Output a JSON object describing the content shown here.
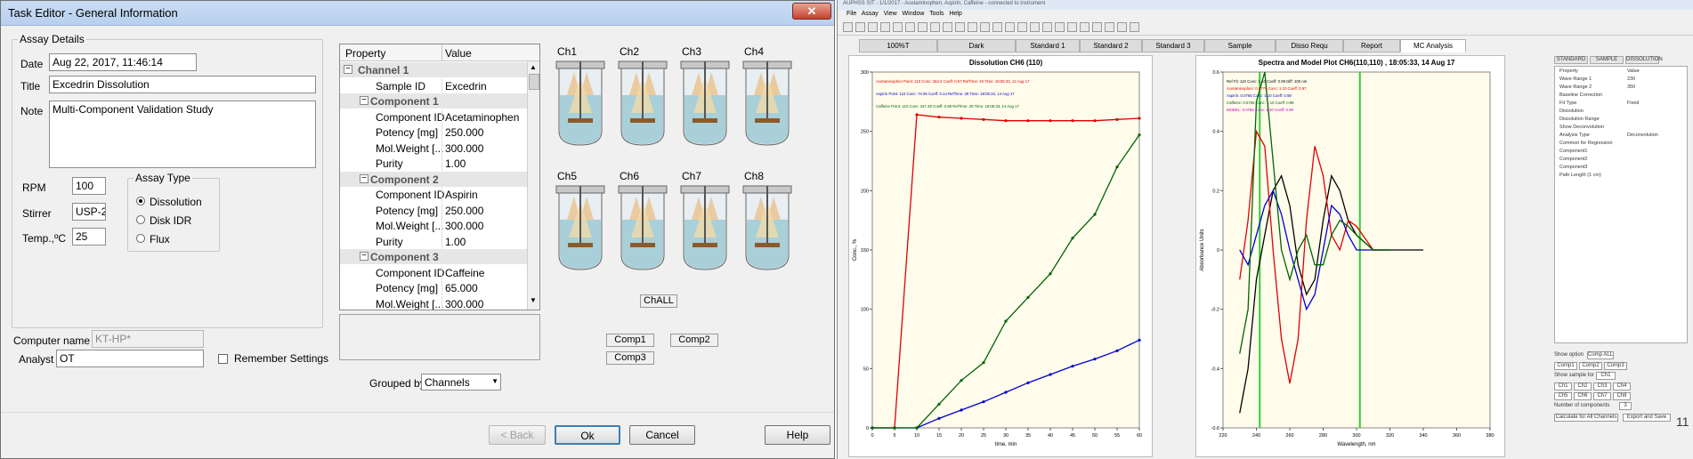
{
  "dialog": {
    "title": "Task Editor - General Information",
    "close_symbol": "✕",
    "assay_details": {
      "legend": "Assay Details",
      "date_label": "Date",
      "date_value": "Aug 22, 2017, 11:46:14",
      "title_label": "Title",
      "title_value": "Excedrin Dissolution",
      "note_label": "Note",
      "note_value": "Multi-Component Validation Study",
      "rpm_label": "RPM",
      "rpm_value": "100",
      "stirrer_label": "Stirrer",
      "stirrer_value": "USP-2",
      "temp_label": "Temp.,ºC",
      "temp_value": "25",
      "assay_type": {
        "legend": "Assay Type",
        "options": [
          "Dissolution",
          "Disk IDR",
          "Flux"
        ],
        "selected": "Dissolution"
      }
    },
    "computer_name_label": "Computer name",
    "computer_name_value": "KT-HP*",
    "analyst_label": "Analyst",
    "analyst_value": "OT",
    "remember_label": "Remember Settings",
    "grid": {
      "col_property": "Property",
      "col_value": "Value",
      "rows": [
        {
          "type": "group",
          "label": "Channel 1"
        },
        {
          "type": "item",
          "label": "Sample ID",
          "value": "Excedrin"
        },
        {
          "type": "subgroup",
          "label": "Component 1"
        },
        {
          "type": "item",
          "label": "Component ID",
          "value": "Acetaminophen"
        },
        {
          "type": "item",
          "label": "Potency [mg]",
          "value": "250.000"
        },
        {
          "type": "item",
          "label": "Mol.Weight [...",
          "value": "300.000"
        },
        {
          "type": "item",
          "label": "Purity",
          "value": "1.00"
        },
        {
          "type": "subgroup",
          "label": "Component 2"
        },
        {
          "type": "item",
          "label": "Component ID",
          "value": "Aspirin"
        },
        {
          "type": "item",
          "label": "Potency [mg]",
          "value": "250.000"
        },
        {
          "type": "item",
          "label": "Mol.Weight [...",
          "value": "300.000"
        },
        {
          "type": "item",
          "label": "Purity",
          "value": "1.00"
        },
        {
          "type": "subgroup",
          "label": "Component 3"
        },
        {
          "type": "item",
          "label": "Component ID",
          "value": "Caffeine"
        },
        {
          "type": "item",
          "label": "Potency [mg]",
          "value": "65.000"
        },
        {
          "type": "item",
          "label": "Mol.Weight [...",
          "value": "300.000"
        },
        {
          "type": "item",
          "label": "Purity",
          "value": "1.00"
        }
      ]
    },
    "grouped_by_label": "Grouped by",
    "grouped_by_value": "Channels",
    "channels": [
      "Ch1",
      "Ch2",
      "Ch3",
      "Ch4",
      "Ch5",
      "Ch6",
      "Ch7",
      "Ch8"
    ],
    "chall_label": "ChALL",
    "comp_buttons": [
      "Comp1",
      "Comp2",
      "Comp3"
    ],
    "buttons": {
      "back": "< Back",
      "ok": "Ok",
      "cancel": "Cancel",
      "help": "Help"
    }
  },
  "app": {
    "title": "AUPHSS SIT - 1/1/2017 - Acetaminophen, Aspirin, Caffeine - connected to instrument",
    "menu": [
      "File",
      "Assay",
      "View",
      "Window",
      "Tools",
      "Help"
    ],
    "tabs": [
      "100%T",
      "Dark",
      "Standard 1",
      "Standard 2",
      "Standard 3",
      "Sample",
      "Disso Requ",
      "Report",
      "MC Analysis"
    ],
    "active_tab": "MC Analysis",
    "side_tabs": [
      "STANDARD",
      "SAMPLE",
      "DISSOLUTION"
    ],
    "side_properties": [
      {
        "label": "Property",
        "value": "Value"
      },
      {
        "label": "Wave Range 1",
        "value": "230"
      },
      {
        "label": "Wave Range 2",
        "value": "350"
      },
      {
        "label": "Baseline Correction",
        "value": ""
      },
      {
        "label": "Fit Type",
        "value": "Fixed"
      },
      {
        "label": "Dissolution",
        "value": ""
      },
      {
        "label": "Dissolution Range",
        "value": ""
      },
      {
        "label": "Show Deconvolution",
        "value": ""
      },
      {
        "label": "Analysis Type",
        "value": "Deconvolution"
      },
      {
        "label": "Common for Regression",
        "value": ""
      },
      {
        "label": "Component1",
        "value": ""
      },
      {
        "label": "Component2",
        "value": ""
      },
      {
        "label": "Component3",
        "value": ""
      },
      {
        "label": "Path Length (1 cm)",
        "value": ""
      }
    ],
    "side_footer": {
      "show_option_label": "Show option",
      "show_option_value": "Comp ALL",
      "comp_buttons": [
        "Comp1",
        "Comp2",
        "Comp3"
      ],
      "show_sample_label": "Show sample for",
      "show_sample_value": "Ch1",
      "ch_buttons": [
        "Ch1",
        "Ch2",
        "Ch3",
        "Ch4",
        "Ch5",
        "Ch6",
        "Ch7",
        "Ch8"
      ],
      "num_components_label": "Number of components",
      "num_components_value": "3",
      "calc_all_button": "Calculate for All Channels",
      "export_button": "Export and Save",
      "pause_symbol": "11"
    }
  },
  "chart_data": [
    {
      "type": "line",
      "title": "Dissolution CH6 (110)",
      "xlabel": "time, min",
      "ylabel": "Conc., %",
      "xlim": [
        0,
        60
      ],
      "ylim": [
        0,
        300
      ],
      "x_ticks": [
        0,
        5,
        10,
        15,
        20,
        25,
        30,
        35,
        40,
        45,
        50,
        55,
        60
      ],
      "y_ticks": [
        0,
        50,
        100,
        150,
        200,
        250,
        300
      ],
      "legend": [
        "Acetaminophen Point: 110 Conc: 264.3 Coeff: 0.97 RefTime: 40 Time: 18:05:33, 14 Aug 17",
        "Aspirin Point: 110 Conc: 74.06 Coeff: 0.14 RefTime: 29 Time: 18:05:33, 14 Aug 17",
        "Caffeine Point: 110 Conc: 247.49 Coeff: 0.98 RefTime: 29 Time: 18:05:33, 14 Aug 17"
      ],
      "series": [
        {
          "name": "Acetaminophen",
          "color": "#e00000",
          "x": [
            0,
            5,
            10,
            15,
            20,
            25,
            30,
            35,
            40,
            45,
            50,
            55,
            60
          ],
          "values": [
            0,
            0,
            264,
            262,
            261,
            260,
            259,
            259,
            259,
            259,
            259,
            260,
            261
          ]
        },
        {
          "name": "Aspirin",
          "color": "#0000d0",
          "x": [
            0,
            5,
            10,
            15,
            20,
            25,
            30,
            35,
            40,
            45,
            50,
            55,
            60
          ],
          "values": [
            0,
            0,
            0,
            8,
            15,
            22,
            30,
            38,
            45,
            52,
            58,
            65,
            74
          ]
        },
        {
          "name": "Caffeine",
          "color": "#006400",
          "x": [
            0,
            5,
            10,
            15,
            20,
            25,
            30,
            35,
            40,
            45,
            50,
            55,
            60
          ],
          "values": [
            0,
            0,
            0,
            20,
            40,
            55,
            90,
            110,
            130,
            160,
            180,
            220,
            247
          ]
        }
      ]
    },
    {
      "type": "line",
      "title": "Spectra and Model Plot CH6(110,110) , 18:05:33, 14 Aug 17",
      "xlabel": "Wavelength, nm",
      "ylabel": "Absorbance Units",
      "xlim": [
        220,
        380
      ],
      "ylim": [
        -0.6,
        0.6
      ],
      "x_ticks": [
        220,
        240,
        260,
        280,
        300,
        320,
        340,
        360,
        380
      ],
      "y_ticks": [
        -0.6,
        -0.4,
        -0.2,
        0,
        0.2,
        0.4,
        0.6
      ],
      "vertical_markers": [
        242,
        302
      ],
      "legend": [
        "Ref Fit: 110 Conc: 1.10 Coeff: 0.99 Diff: 100 nm",
        "Acetaminophen: 0.0770 Conc: 1.10 Coeff: 0.97",
        "Aspirin: 0.0765 Conc: 1.10 Coeff: 0.98",
        "Caffeine: 0.0756 Conc: 1.10 Coeff: 0.98",
        "MODEL: 0.0756 Conc: 1.10 Coeff: 0.99"
      ],
      "series": [
        {
          "name": "Sample",
          "color": "#000000",
          "x": [
            230,
            235,
            240,
            245,
            250,
            255,
            260,
            265,
            270,
            275,
            280,
            285,
            290,
            295,
            300,
            310,
            320,
            330,
            340
          ],
          "values": [
            -0.55,
            -0.4,
            -0.1,
            0.05,
            0.2,
            0.25,
            0.15,
            -0.05,
            -0.15,
            -0.1,
            0.1,
            0.25,
            0.2,
            0.1,
            0.05,
            0.0,
            0.0,
            0.0,
            0.0
          ]
        },
        {
          "name": "Acetaminophen",
          "color": "#e00000",
          "x": [
            230,
            235,
            240,
            245,
            250,
            255,
            260,
            265,
            270,
            275,
            280,
            285,
            290,
            295,
            300,
            310,
            320
          ],
          "values": [
            -0.1,
            0.1,
            0.4,
            0.35,
            0.0,
            -0.3,
            -0.45,
            -0.3,
            0.1,
            0.35,
            0.25,
            0.05,
            0.0,
            0.1,
            0.08,
            0.0,
            0.0
          ]
        },
        {
          "name": "Aspirin",
          "color": "#0000d0",
          "x": [
            230,
            235,
            240,
            245,
            250,
            255,
            260,
            265,
            270,
            275,
            280,
            285,
            290,
            295,
            300,
            310,
            320
          ],
          "values": [
            0.0,
            -0.05,
            0.05,
            0.15,
            0.2,
            0.12,
            0.0,
            -0.1,
            -0.2,
            -0.15,
            0.0,
            0.15,
            0.12,
            0.05,
            0.0,
            0.0,
            0.0
          ]
        },
        {
          "name": "Caffeine",
          "color": "#006400",
          "x": [
            230,
            235,
            240,
            245,
            250,
            255,
            260,
            265,
            270,
            275,
            280,
            285,
            290,
            295,
            300,
            310,
            320
          ],
          "values": [
            -0.35,
            -0.2,
            0.5,
            0.6,
            0.3,
            0.0,
            -0.1,
            0.0,
            0.05,
            -0.05,
            -0.05,
            0.05,
            0.1,
            0.08,
            0.05,
            0.0,
            0.0
          ]
        }
      ]
    }
  ]
}
